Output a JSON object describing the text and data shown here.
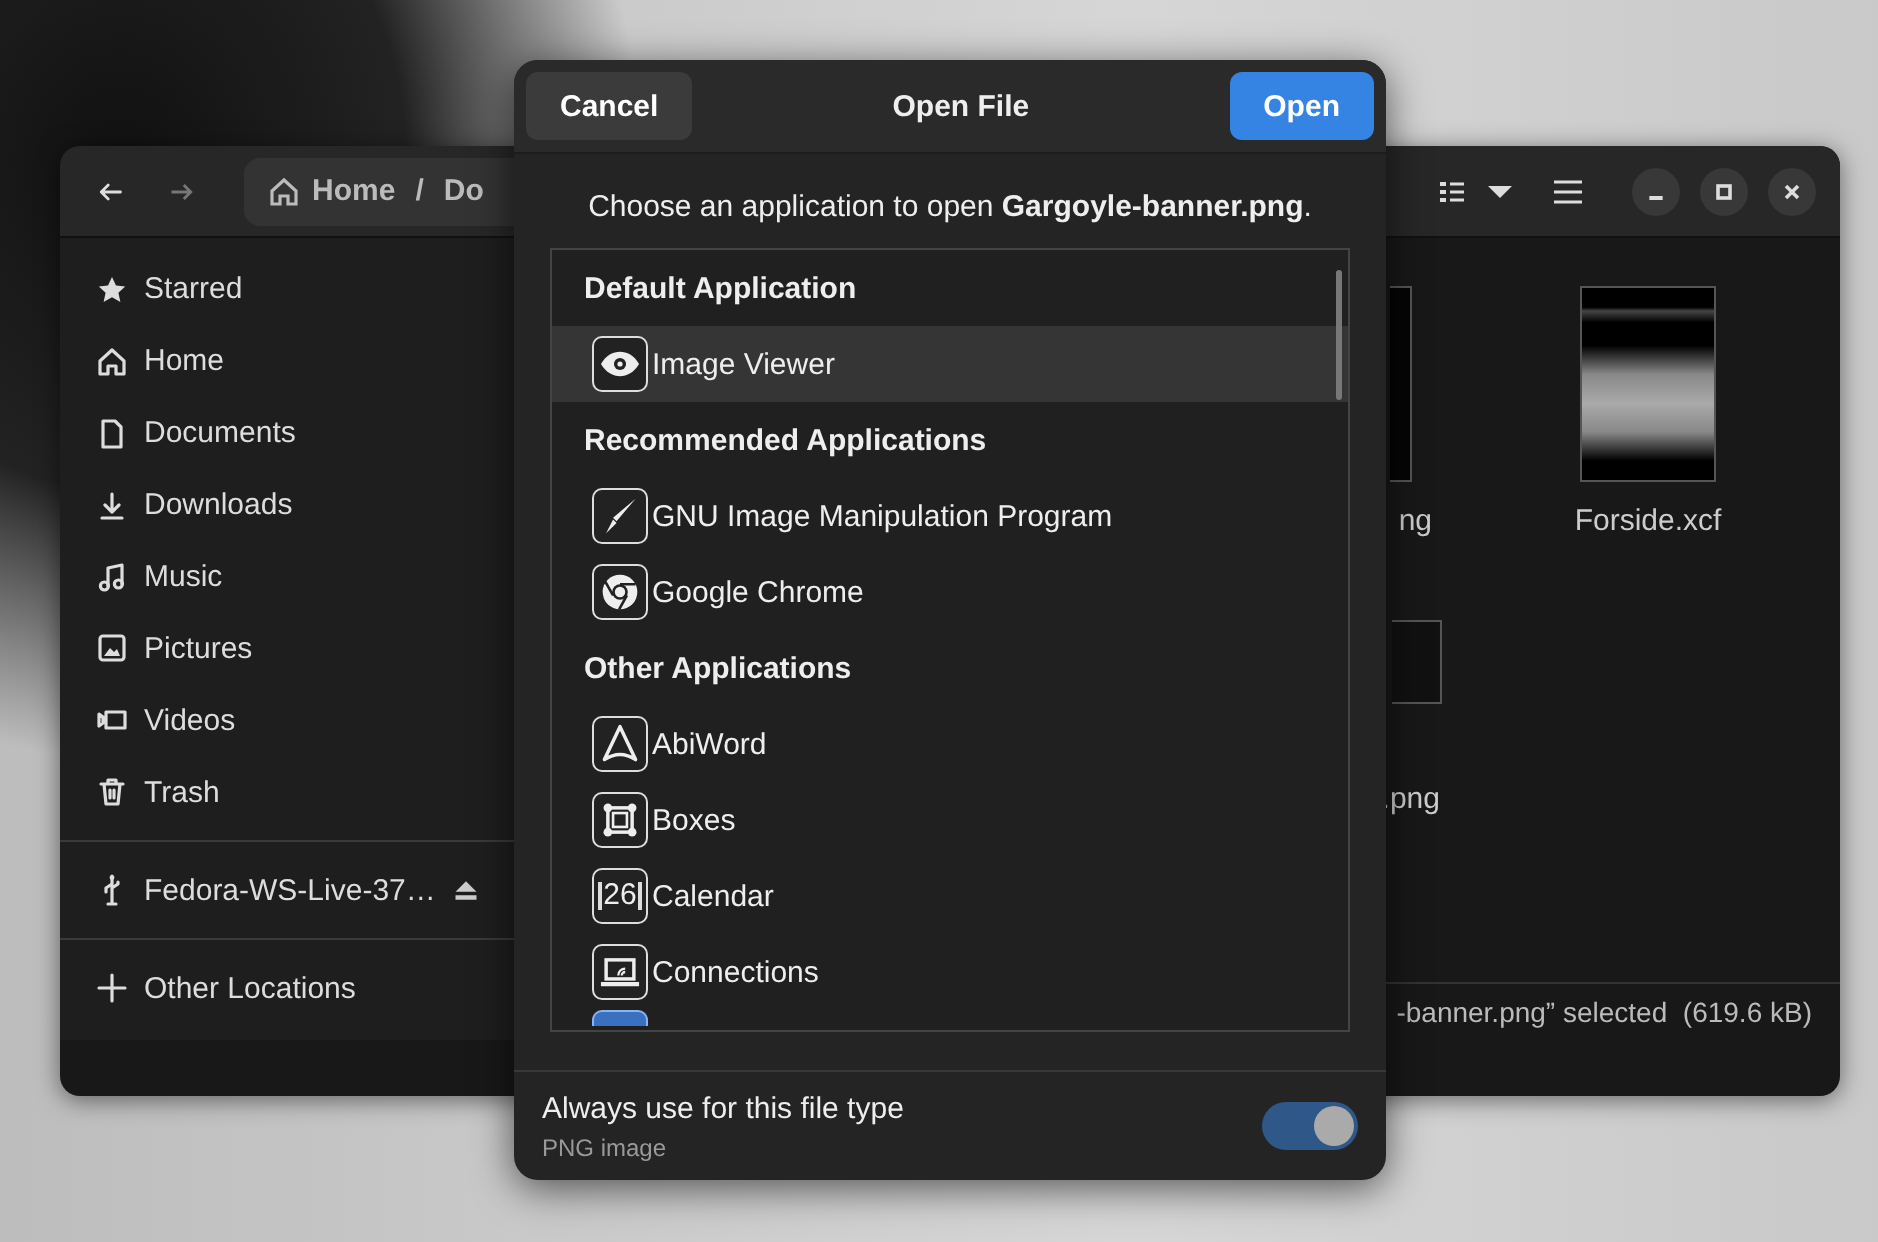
{
  "file_manager": {
    "breadcrumb": [
      "Home",
      "/",
      "Do"
    ],
    "sidebar": {
      "places": [
        {
          "label": "Starred",
          "selected": false
        },
        {
          "label": "Home",
          "selected": false
        },
        {
          "label": "Documents",
          "selected": false
        },
        {
          "label": "Downloads",
          "selected": false
        },
        {
          "label": "Music",
          "selected": false
        },
        {
          "label": "Pictures",
          "selected": false
        },
        {
          "label": "Videos",
          "selected": false
        },
        {
          "label": "Trash",
          "selected": false
        }
      ],
      "devices": [
        {
          "label": "Fedora-WS-Live-37…",
          "selected": false
        }
      ],
      "other": [
        {
          "label": "Other Locations",
          "selected": false
        }
      ]
    },
    "files": [
      {
        "name": "ng"
      },
      {
        "name": "Forside.xcf"
      },
      {
        "name": ".png"
      }
    ],
    "status": "-banner.png” selected  (619.6 kB)"
  },
  "dialog": {
    "title": "Open File",
    "cancel": "Cancel",
    "open": "Open",
    "prompt": "Choose an application to open **Gargoyle-banner.png**.",
    "sections": [
      {
        "heading": "Default Application",
        "apps": [
          {
            "name": "Image Viewer",
            "selected": true
          }
        ]
      },
      {
        "heading": "Recommended Applications",
        "apps": [
          {
            "name": "GNU Image Manipulation Program",
            "selected": false
          },
          {
            "name": "Google Chrome",
            "selected": false
          }
        ]
      },
      {
        "heading": "Other Applications",
        "apps": [
          {
            "name": "AbiWord",
            "selected": false
          },
          {
            "name": "Boxes",
            "selected": false
          },
          {
            "name": "Calendar",
            "selected": false,
            "icon_text": "26"
          },
          {
            "name": "Connections",
            "selected": false
          }
        ]
      }
    ],
    "always_use": {
      "label": "Always use for this file type",
      "sublabel": "PNG image",
      "on": true
    }
  }
}
